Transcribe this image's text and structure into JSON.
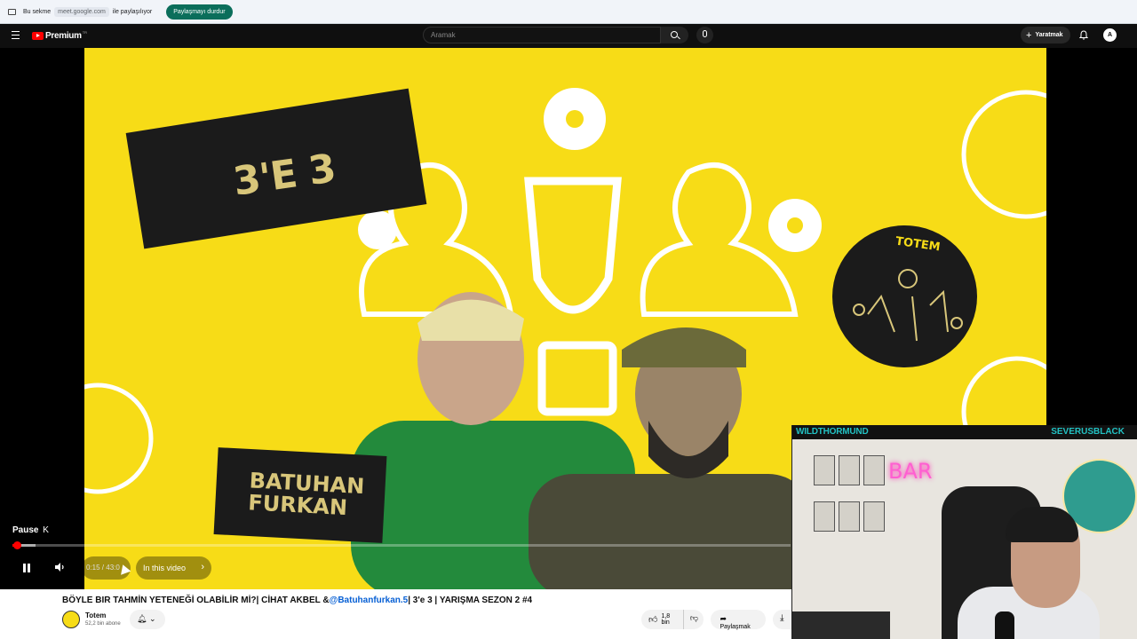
{
  "meet_bar": {
    "text_before": "Bu sekme",
    "domain": "meet.google.com",
    "text_after": "ile paylaşılıyor",
    "stop_button": "Paylaşmayı durdur"
  },
  "header": {
    "logo_text": "Premium",
    "logo_region": "TR",
    "search_placeholder": "Aramak",
    "create_label": "Yaratmak",
    "avatar_letter": "A"
  },
  "thumbnail": {
    "title_text": "3'E 3",
    "name_line1": "BATUHAN",
    "name_line2": "FURKAN",
    "brand": "TOTEM"
  },
  "player": {
    "tooltip": "Pause",
    "tooltip_key": "K",
    "time": "0:15 / 43:0",
    "chapter_label": "In this video",
    "progress_fraction": 0.006
  },
  "webcam": {
    "left_name": "WILDTHORMUND",
    "right_name": "SEVERUSBLACK",
    "neon_sign": "BAR"
  },
  "video": {
    "title_part1": "BÖYLE BIR TAHMİN YETENEĞİ OLABİLİR Mİ?| CİHAT AKBEL &",
    "title_mention": "@Batuhanfurkan.5",
    "title_part2": "| 3'e 3 | YARIŞMA SEZON 2 #4",
    "channel_name": "Totem",
    "subscribers": "52,2 bin abone",
    "likes": "1,8 bin",
    "share_label": "Paylaşmak"
  },
  "icons": {
    "menu": "hamburger-icon",
    "search": "search-icon",
    "mic": "mic-icon",
    "bell": "bell-icon",
    "like": "thumbs-up-icon",
    "dislike": "thumbs-down-icon",
    "share": "share-icon",
    "download": "download-icon"
  },
  "colors": {
    "brand_red": "#ff0000",
    "thumbnail_yellow": "#f7dc17",
    "meet_green": "#0b6e5b",
    "mention_blue": "#065fd4",
    "webcam_text": "#22c1c3"
  }
}
